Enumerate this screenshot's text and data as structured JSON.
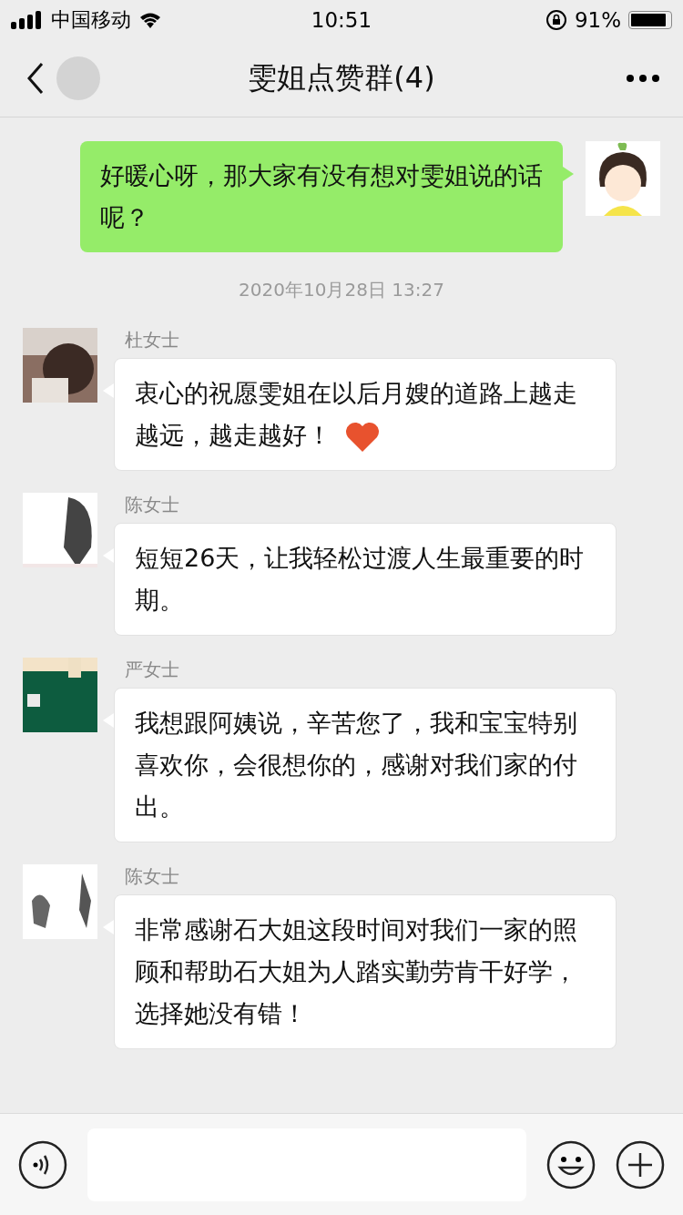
{
  "status_bar": {
    "carrier": "中国移动",
    "time": "10:51",
    "battery": "91%"
  },
  "header": {
    "title": "雯姐点赞群(4)"
  },
  "messages": [
    {
      "kind": "outgoing",
      "text": "好暖心呀，那大家有没有想对雯姐说的话呢？"
    },
    {
      "kind": "timestamp",
      "text": "2020年10月28日 13:27"
    },
    {
      "kind": "incoming",
      "sender": "杜女士",
      "text": "衷心的祝愿雯姐在以后月嫂的道路上越走越远，越走越好！",
      "heart": true
    },
    {
      "kind": "incoming",
      "sender": "陈女士",
      "text": "短短26天，让我轻松过渡人生最重要的时期。"
    },
    {
      "kind": "incoming",
      "sender": "严女士",
      "text": "我想跟阿姨说，辛苦您了，我和宝宝特别喜欢你，会很想你的，感谢对我们家的付出。"
    },
    {
      "kind": "incoming",
      "sender": "陈女士",
      "text": "非常感谢石大姐这段时间对我们一家的照顾和帮助石大姐为人踏实勤劳肯干好学，选择她没有错！"
    }
  ]
}
